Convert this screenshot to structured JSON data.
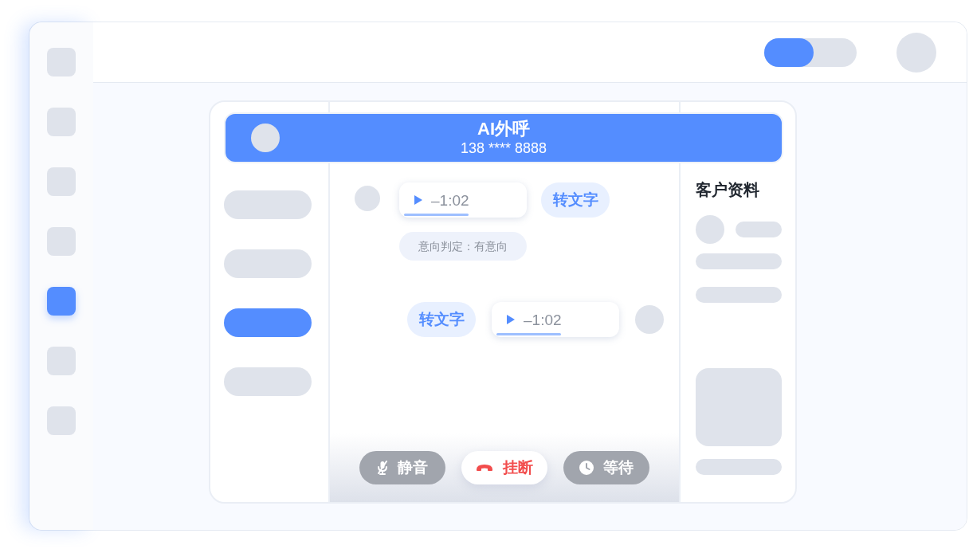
{
  "sidebar": {
    "items": [
      {
        "selected": false
      },
      {
        "selected": false
      },
      {
        "selected": false
      },
      {
        "selected": false
      },
      {
        "selected": true
      },
      {
        "selected": false
      },
      {
        "selected": false
      }
    ]
  },
  "topbar": {
    "toggle": {
      "on": true
    }
  },
  "call": {
    "title": "AI外呼",
    "phone": "138 **** 8888"
  },
  "menu": {
    "items": [
      {
        "selected": false
      },
      {
        "selected": false
      },
      {
        "selected": true
      },
      {
        "selected": false
      }
    ]
  },
  "messages": [
    {
      "kind": "received",
      "duration": "–1:02",
      "level": 0.55,
      "transcribe": "转文字",
      "tag": "意向判定：有意向"
    },
    {
      "kind": "sent",
      "duration": "–1:02",
      "level": 0.55,
      "transcribe": "转文字"
    }
  ],
  "controls": [
    {
      "kind": "mute",
      "label": "静音"
    },
    {
      "kind": "hangup",
      "label": "挂断"
    },
    {
      "kind": "hold",
      "label": "等待"
    }
  ],
  "profile": {
    "title": "客户资料"
  }
}
